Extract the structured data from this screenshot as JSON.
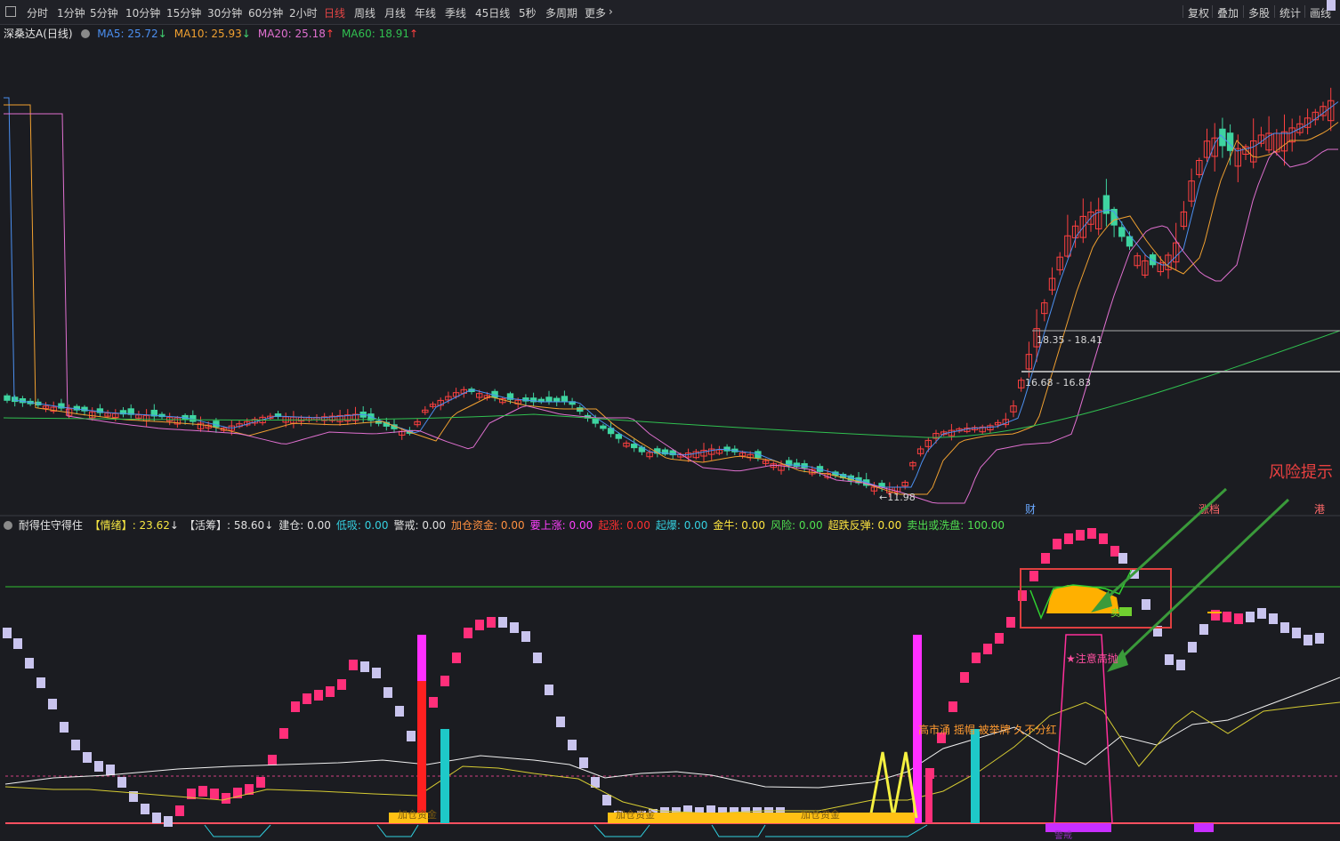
{
  "toolbar": {
    "left_items": [
      {
        "label": "分时"
      },
      {
        "label": "1分钟"
      },
      {
        "label": "5分钟"
      },
      {
        "label": "10分钟"
      },
      {
        "label": "15分钟"
      },
      {
        "label": "30分钟"
      },
      {
        "label": "60分钟"
      },
      {
        "label": "2小时"
      },
      {
        "label": "日线"
      },
      {
        "label": "周线"
      },
      {
        "label": "月线"
      },
      {
        "label": "年线"
      },
      {
        "label": "季线"
      },
      {
        "label": "45日线"
      },
      {
        "label": "5秒"
      },
      {
        "label": "多周期"
      },
      {
        "label": "更多"
      }
    ],
    "active_item": "日线",
    "right_items": [
      {
        "label": "复权"
      },
      {
        "label": "叠加"
      },
      {
        "label": "多股"
      },
      {
        "label": "统计"
      },
      {
        "label": "画线"
      }
    ]
  },
  "main_chart": {
    "stock_name": "深桑达A",
    "period": "(日线)",
    "ma": [
      {
        "label": "MA5",
        "value": "25.72",
        "arrow": "↓",
        "color": "#4b8ff0"
      },
      {
        "label": "MA10",
        "value": "25.93",
        "arrow": "↓",
        "color": "#f0a030"
      },
      {
        "label": "MA20",
        "value": "25.18",
        "arrow": "↑",
        "color": "#e070d0"
      },
      {
        "label": "MA60",
        "value": "18.91",
        "arrow": "↑",
        "color": "#30c050"
      }
    ],
    "price_labels": [
      "18.35 - 18.41",
      "16.68 - 16.83"
    ],
    "low_label": "←11.98",
    "event_tags": [
      {
        "text": "财",
        "color": "#6aa8ff"
      },
      {
        "text": "涨档",
        "color": "#ff6a6a"
      },
      {
        "text": "港",
        "color": "#ff6a6a"
      }
    ],
    "risk_annotation": "风险提示"
  },
  "indicator": {
    "name": "耐得住守得住",
    "fields": [
      {
        "label": "【情绪】",
        "value": "23.62",
        "arrow": "↓",
        "lcolor": "#f5e642",
        "vcolor": "#f5e642"
      },
      {
        "label": "【活筹】",
        "value": "58.60",
        "arrow": "↓",
        "lcolor": "#e0e0e0",
        "vcolor": "#e0e0e0"
      },
      {
        "label": "建仓",
        "value": "0.00",
        "lcolor": "#e0e0e0",
        "vcolor": "#e0e0e0"
      },
      {
        "label": "低吸",
        "value": "0.00",
        "lcolor": "#35d0e0",
        "vcolor": "#35d0e0"
      },
      {
        "label": "警戒",
        "value": "0.00",
        "lcolor": "#e0e0e0",
        "vcolor": "#e0e0e0"
      },
      {
        "label": "加仓资金",
        "value": "0.00",
        "lcolor": "#ff9040",
        "vcolor": "#ff9040"
      },
      {
        "label": "要上涨",
        "value": "0.00",
        "lcolor": "#ff40ff",
        "vcolor": "#ff40ff"
      },
      {
        "label": "起涨",
        "value": "0.00",
        "lcolor": "#ff3030",
        "vcolor": "#ff3030"
      },
      {
        "label": "起爆",
        "value": "0.00",
        "lcolor": "#35d0e0",
        "vcolor": "#35d0e0"
      },
      {
        "label": "金牛",
        "value": "0.00",
        "lcolor": "#ffe640",
        "vcolor": "#ffe640"
      },
      {
        "label": "风险",
        "value": "0.00",
        "lcolor": "#50e050",
        "vcolor": "#50e050"
      },
      {
        "label": "超跌反弹",
        "value": "0.00",
        "lcolor": "#ffe640",
        "vcolor": "#ffe640"
      },
      {
        "label": "卖出或洗盘",
        "value": "100.00",
        "lcolor": "#50e050",
        "vcolor": "#50e050"
      }
    ],
    "texts": {
      "add_fund": "加仓资金",
      "warn_top": "★注意高抛",
      "market_note": "高市涌 摇帽 被举牌 久不分红",
      "sell_mark": "卖",
      "bottom_warn": "警戒"
    }
  }
}
